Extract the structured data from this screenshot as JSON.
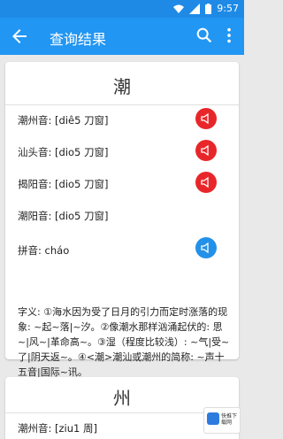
{
  "status": {
    "time": "9:57"
  },
  "appbar": {
    "title": "查询结果"
  },
  "card1": {
    "character": "潮",
    "rows": [
      {
        "text": "潮州音: [diê5 刀窗]",
        "sound": "red"
      },
      {
        "text": "汕头音: [dio5 刀窗]",
        "sound": "red"
      },
      {
        "text": "揭阳音: [dio5 刀窗]",
        "sound": "red"
      },
      {
        "text": "潮阳音: [dio5 刀窗]",
        "sound": ""
      },
      {
        "text": "拼音: cháo",
        "sound": "blue"
      }
    ],
    "meaning": "字义: ①海水因为受了日月的引力而定时涨落的现象: ~起~落|~汐。②像潮水那样汹涌起伏的: 思~|风~|革命高~。③湿（程度比较浅）: ~气|受~了|阴天返~。④<潮>潮汕或潮州的简称: ~声十五音|国际~讯。"
  },
  "card2": {
    "character": "州",
    "rows": [
      {
        "text": "潮州音: [ziu1 周]"
      }
    ]
  },
  "watermark": {
    "text": "快推下载网"
  },
  "colors": {
    "primary": "#2196f3",
    "status": "#1f8ae6",
    "sound_red": "#e8262a",
    "sound_blue": "#2391e8"
  }
}
